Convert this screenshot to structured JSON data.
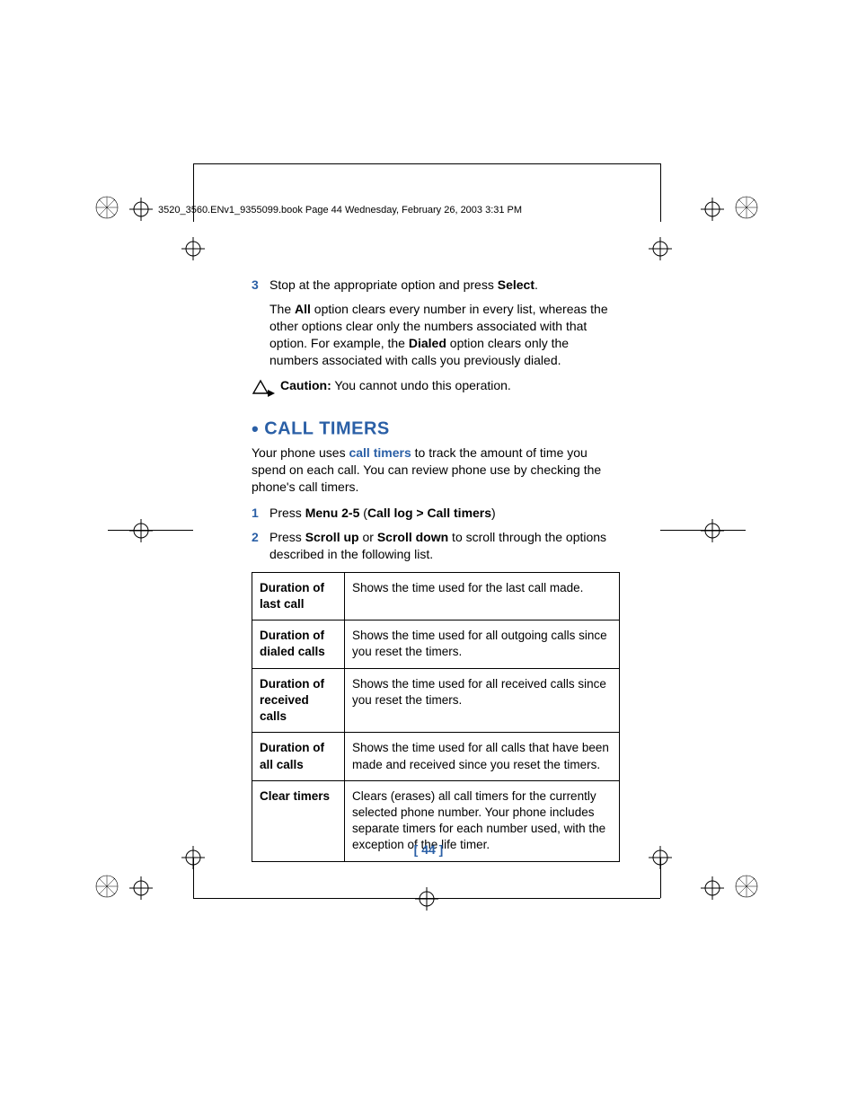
{
  "header_text": "3520_3560.ENv1_9355099.book  Page 44  Wednesday, February 26, 2003  3:31 PM",
  "step3": {
    "num": "3",
    "pre": "Stop at the appropriate option and press ",
    "bold": "Select",
    "post": "."
  },
  "para_all": {
    "t1": "The ",
    "b1": "All",
    "t2": " option clears every number in every list, whereas the other options clear only the numbers associated with that option. For example, the ",
    "b2": "Dialed",
    "t3": " option clears only the numbers associated with calls you previously dialed."
  },
  "caution": {
    "label": "Caution:",
    "text": " You cannot undo this operation."
  },
  "section_title": "CALL TIMERS",
  "intro": {
    "t1": "Your phone uses ",
    "link": "call timers",
    "t2": " to track the amount of time you spend on each call. You can review phone use by checking the phone's call timers."
  },
  "step1": {
    "num": "1",
    "t1": "Press ",
    "b1": "Menu 2-5",
    "t2": " (",
    "b2": "Call log > Call timers",
    "t3": ")"
  },
  "step2": {
    "num": "2",
    "t1": "Press ",
    "b1": "Scroll up",
    "t2": " or ",
    "b2": "Scroll down",
    "t3": " to scroll through the options described in the following list."
  },
  "table": [
    {
      "label": "Duration of last call",
      "desc": "Shows the time used for the last call made."
    },
    {
      "label": "Duration of dialed calls",
      "desc": "Shows the time used for all outgoing calls since you reset the timers."
    },
    {
      "label": "Duration of received calls",
      "desc": "Shows the time used for all received calls since you reset the timers."
    },
    {
      "label": "Duration of all calls",
      "desc": "Shows the time used for all calls that have been made and received since you reset the timers."
    },
    {
      "label": "Clear timers",
      "desc": "Clears (erases) all call timers for the currently selected phone number. Your phone includes separate timers for each number used, with the exception of the life timer."
    }
  ],
  "page_num": "[ 44 ]"
}
